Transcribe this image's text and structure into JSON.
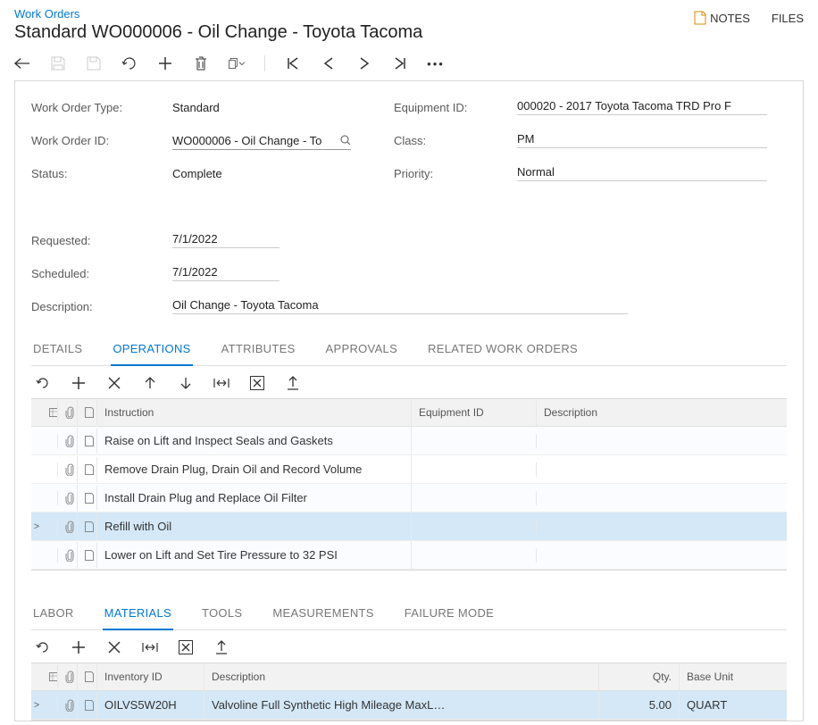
{
  "header": {
    "breadcrumb": "Work Orders",
    "title": "Standard WO000006 - Oil Change - Toyota Tacoma",
    "notes_label": "NOTES",
    "files_label": "FILES"
  },
  "fields": {
    "wo_type_label": "Work Order Type:",
    "wo_type_value": "Standard",
    "wo_id_label": "Work Order ID:",
    "wo_id_value": "WO000006 - Oil Change - To",
    "status_label": "Status:",
    "status_value": "Complete",
    "equipment_label": "Equipment ID:",
    "equipment_value": "000020 - 2017 Toyota Tacoma TRD Pro F",
    "class_label": "Class:",
    "class_value": "PM",
    "priority_label": "Priority:",
    "priority_value": "Normal",
    "requested_label": "Requested:",
    "requested_value": "7/1/2022",
    "scheduled_label": "Scheduled:",
    "scheduled_value": "7/1/2022",
    "description_label": "Description:",
    "description_value": "Oil Change - Toyota Tacoma"
  },
  "tabs1": [
    {
      "label": "DETAILS",
      "active": false
    },
    {
      "label": "OPERATIONS",
      "active": true
    },
    {
      "label": "ATTRIBUTES",
      "active": false
    },
    {
      "label": "APPROVALS",
      "active": false
    },
    {
      "label": "RELATED WORK ORDERS",
      "active": false
    }
  ],
  "ops_columns": {
    "instruction": "Instruction",
    "equipment": "Equipment ID",
    "description": "Description"
  },
  "ops_rows": [
    {
      "instruction": "Raise on Lift and Inspect Seals and Gaskets",
      "selected": false
    },
    {
      "instruction": "Remove Drain Plug, Drain Oil and Record Volume",
      "selected": false
    },
    {
      "instruction": "Install Drain Plug and Replace Oil Filter",
      "selected": false
    },
    {
      "instruction": "Refill with Oil",
      "selected": true
    },
    {
      "instruction": "Lower on Lift and Set Tire Pressure to 32 PSI",
      "selected": false
    }
  ],
  "tabs2": [
    {
      "label": "LABOR",
      "active": false
    },
    {
      "label": "MATERIALS",
      "active": true
    },
    {
      "label": "TOOLS",
      "active": false
    },
    {
      "label": "MEASUREMENTS",
      "active": false
    },
    {
      "label": "FAILURE MODE",
      "active": false
    }
  ],
  "mat_columns": {
    "inventory": "Inventory ID",
    "description": "Description",
    "qty": "Qty.",
    "unit": "Base Unit"
  },
  "mat_rows": [
    {
      "inventory": "OILVS5W20H",
      "description": "Valvoline Full Synthetic High Mileage MaxL…",
      "qty": "5.00",
      "unit": "QUART",
      "selected": true
    }
  ]
}
